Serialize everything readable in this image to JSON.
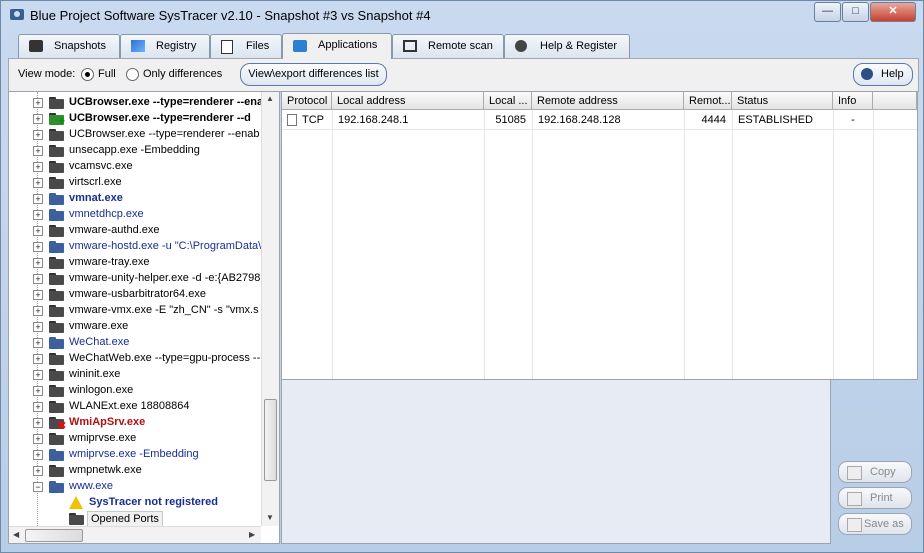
{
  "window": {
    "title": "Blue Project Software SysTracer v2.10 - Snapshot #3 vs Snapshot #4"
  },
  "tabs": [
    {
      "label": "Snapshots",
      "icon": "camera-icon"
    },
    {
      "label": "Registry",
      "icon": "registry-icon"
    },
    {
      "label": "Files",
      "icon": "files-icon"
    },
    {
      "label": "Applications",
      "icon": "applications-icon",
      "active": true
    },
    {
      "label": "Remote scan",
      "icon": "network-icon"
    },
    {
      "label": "Help & Register",
      "icon": "help-icon"
    }
  ],
  "toolbar": {
    "view_mode_label": "View mode:",
    "full_label": "Full",
    "only_diff_label": "Only differences",
    "selected": "full",
    "export_label": "View\\export differences list",
    "help_label": "Help"
  },
  "tree": [
    {
      "text": "UCBrowser.exe --type=renderer --enab",
      "icon": "folder-icon",
      "style": "bold"
    },
    {
      "text": "UCBrowser.exe --type=renderer --d",
      "icon": "added-folder-icon",
      "style": "bold"
    },
    {
      "text": "UCBrowser.exe --type=renderer --enab",
      "icon": "folder-icon",
      "style": ""
    },
    {
      "text": "unsecapp.exe -Embedding",
      "icon": "folder-icon",
      "style": ""
    },
    {
      "text": "vcamsvc.exe",
      "icon": "folder-icon",
      "style": ""
    },
    {
      "text": "virtscrl.exe",
      "icon": "folder-icon",
      "style": ""
    },
    {
      "text": "vmnat.exe",
      "icon": "folder-icon",
      "style": "blue-bold"
    },
    {
      "text": "vmnetdhcp.exe",
      "icon": "folder-icon",
      "style": "blue"
    },
    {
      "text": "vmware-authd.exe",
      "icon": "folder-icon",
      "style": ""
    },
    {
      "text": "vmware-hostd.exe -u \"C:\\ProgramData\\",
      "icon": "folder-icon",
      "style": "blue"
    },
    {
      "text": "vmware-tray.exe",
      "icon": "folder-icon",
      "style": ""
    },
    {
      "text": "vmware-unity-helper.exe -d -e:{AB2798",
      "icon": "folder-icon",
      "style": ""
    },
    {
      "text": "vmware-usbarbitrator64.exe",
      "icon": "folder-icon",
      "style": ""
    },
    {
      "text": "vmware-vmx.exe -E \"zh_CN\" -s \"vmx.s",
      "icon": "folder-icon",
      "style": ""
    },
    {
      "text": "vmware.exe",
      "icon": "folder-icon",
      "style": ""
    },
    {
      "text": "WeChat.exe",
      "icon": "folder-icon",
      "style": "blue"
    },
    {
      "text": "WeChatWeb.exe --type=gpu-process --",
      "icon": "folder-icon",
      "style": ""
    },
    {
      "text": "wininit.exe",
      "icon": "folder-icon",
      "style": ""
    },
    {
      "text": "winlogon.exe",
      "icon": "folder-icon",
      "style": ""
    },
    {
      "text": "WLANExt.exe 18808864",
      "icon": "folder-icon",
      "style": ""
    },
    {
      "text": "WmiApSrv.exe",
      "icon": "removed-folder-icon",
      "style": "red"
    },
    {
      "text": "wmiprvse.exe",
      "icon": "folder-icon",
      "style": ""
    },
    {
      "text": "wmiprvse.exe -Embedding",
      "icon": "folder-icon",
      "style": "blue"
    },
    {
      "text": "wmpnetwk.exe",
      "icon": "folder-icon",
      "style": ""
    },
    {
      "text": "www.exe",
      "icon": "folder-icon",
      "style": "blue",
      "expanded": true
    }
  ],
  "tree_children": [
    {
      "text": "SysTracer not registered",
      "icon": "warning-icon",
      "style": "blue-bold"
    },
    {
      "text": "Opened Ports",
      "icon": "folder-icon",
      "style": "selected"
    }
  ],
  "grid": {
    "columns": [
      "Protocol",
      "Local address",
      "Local ...",
      "Remote address",
      "Remot...",
      "Status",
      "Info"
    ],
    "rows": [
      [
        "TCP",
        "192.168.248.1",
        "51085",
        "192.168.248.128",
        "4444",
        "ESTABLISHED",
        "-"
      ]
    ]
  },
  "actions": {
    "copy": "Copy",
    "print": "Print",
    "save_as": "Save as"
  },
  "colors": {
    "accent": "#1a2d8f",
    "removed": "#b01010",
    "frame": "#c9daf0"
  }
}
